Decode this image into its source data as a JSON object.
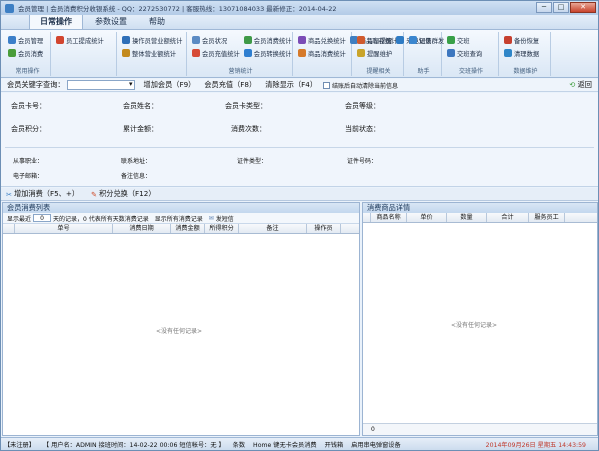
{
  "window": {
    "title": "会员管理 | 会员消费积分收银系统 - QQ：2272530772 | 客服热线：13071084033 最新修正：2014-04-22",
    "min": "─",
    "max": "□",
    "close": "✕"
  },
  "menu": [
    "日常操作",
    "参数设置",
    "帮助"
  ],
  "ribbon": {
    "groups": [
      {
        "label": "常用操作",
        "items": [
          {
            "text": "会员管理",
            "icon": "user-card-icon",
            "color": "#3c7fc9"
          },
          {
            "text": "会员消费",
            "icon": "cart-icon",
            "color": "#4a9d3a"
          }
        ]
      },
      {
        "label": "",
        "items": [
          {
            "text": "员工提成统计",
            "icon": "chart-icon",
            "color": "#d2452f"
          }
        ]
      },
      {
        "label": "",
        "items": [
          {
            "text": "操作员营业额统计",
            "icon": "report-icon",
            "color": "#2e6fb8"
          },
          {
            "text": "整体营业额统计",
            "icon": "stats-icon",
            "color": "#c38a1d"
          }
        ]
      },
      {
        "label": "营销统计",
        "items": [
          {
            "text": "会员状况",
            "icon": "status-icon",
            "color": "#5b8bc4"
          },
          {
            "text": "会员充值统计",
            "icon": "recharge-icon",
            "color": "#d64b36"
          },
          {
            "text": "会员消费统计",
            "icon": "consume-icon",
            "color": "#3f9a48"
          },
          {
            "text": "会员转换统计",
            "icon": "convert-icon",
            "color": "#2f7fd0"
          }
        ]
      },
      {
        "label": "",
        "items": [
          {
            "text": "商品兑换统计",
            "icon": "exchange-icon",
            "color": "#7b4cb6"
          },
          {
            "text": "商品消费统计",
            "icon": "goods-icon",
            "color": "#d67a2a"
          },
          {
            "text": "商品库存统计",
            "icon": "stock-icon",
            "color": "#3f7fc1"
          }
        ]
      },
      {
        "label": "提醒相关",
        "items": [
          {
            "text": "每日提醒",
            "icon": "clock-icon",
            "color": "#d05a2e"
          },
          {
            "text": "提醒维护",
            "icon": "bell-icon",
            "color": "#c9a42a"
          },
          {
            "text": "来电记录",
            "icon": "phone-icon",
            "color": "#2e7bc4"
          }
        ]
      },
      {
        "label": "助手",
        "items": [
          {
            "text": "短信群发",
            "icon": "sms-icon",
            "color": "#3b86cf"
          }
        ]
      },
      {
        "label": "交班操作",
        "items": [
          {
            "text": "交班",
            "icon": "check-icon",
            "color": "#38a048"
          },
          {
            "text": "交班查询",
            "icon": "query-icon",
            "color": "#3d77bf"
          }
        ]
      },
      {
        "label": "数据维护",
        "items": [
          {
            "text": "备份恢复",
            "icon": "backup-icon",
            "color": "#c6402f"
          },
          {
            "text": "清理数据",
            "icon": "clean-icon",
            "color": "#2f86c8"
          }
        ]
      }
    ]
  },
  "search": {
    "label": "会员关键字查询：",
    "add_member": "增加会员（F9）",
    "recharge": "会员充值（F8）",
    "clear": "清除显示（F4）",
    "auto_clear_note": "结账后自动清除当前信息",
    "back": "返回"
  },
  "info": {
    "card_no": "会员卡号：",
    "name": "会员姓名：",
    "card_type": "会员卡类型：",
    "level": "会员等级：",
    "points": "会员积分：",
    "total": "累计金额：",
    "count": "消费次数：",
    "state": "当前状态：",
    "job": "从事职业：",
    "address": "联系地址：",
    "id_type": "证件类型：",
    "id_no": "证件号码：",
    "email": "电子邮箱：",
    "remark": "备注信息："
  },
  "actions": {
    "add_consume": "增加消费（F5、+）",
    "points_exchange": "积分兑换（F12）"
  },
  "left_pane": {
    "title": "会员消费列表",
    "filter_prefix": "显示最近",
    "days": "0",
    "filter_suffix": "天的记录，0 代表所有天数消费记录",
    "show_all": "显示所有消费记录",
    "sms": "发短信",
    "columns": [
      "单号",
      "消费日期",
      "消费金额",
      "所得积分",
      "备注",
      "操作员"
    ],
    "empty": "<没有任何记录>"
  },
  "right_pane": {
    "title": "消费商品详情",
    "columns": [
      "商品名称",
      "单价",
      "数量",
      "合计",
      "服务员工"
    ],
    "empty": "<没有任何记录>",
    "footer_value": "0"
  },
  "status": {
    "registered": "【未注册】",
    "user": "【 用户名：ADMIN 接班时间：14-02-22 00:06 短信帐号：无 】",
    "count": "条数",
    "home": "Home 键无卡会员消费",
    "switch": "开钱箱",
    "shortcut": "启用串电弹窗设备",
    "datetime": "2014年09月26日 星期五 14:43:59"
  }
}
